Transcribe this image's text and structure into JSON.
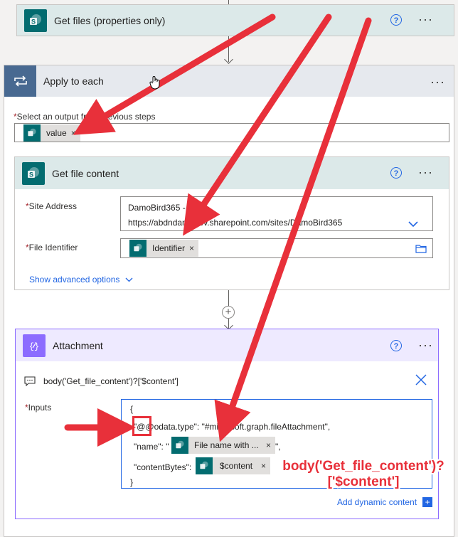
{
  "get_files": {
    "title": "Get files (properties only)"
  },
  "apply_each": {
    "title": "Apply to each",
    "select_label": "Select an output from previous steps",
    "token_value": "value"
  },
  "get_file_content": {
    "title": "Get file content",
    "site_label": "Site Address",
    "site_line1": "DamoBird365 -",
    "site_line2": "https://abdndamodev.sharepoint.com/sites/DamoBird365",
    "file_label": "File Identifier",
    "file_token": "Identifier",
    "advanced": "Show advanced options"
  },
  "attachment": {
    "title": "Attachment",
    "expression": "body('Get_file_content')?['$content']",
    "inputs_label": "Inputs",
    "json_open": "{",
    "odata_line": "\"@@odata.type\": \"#microsoft.graph.fileAttachment\",",
    "name_key": "\"name\": \"",
    "name_token": "File name with ...",
    "name_tail": "\",",
    "content_key": "\"contentBytes\":",
    "content_token": "$content",
    "json_close": "}",
    "add_dynamic": "Add dynamic content"
  },
  "common": {
    "help": "?",
    "more": "···",
    "remove": "×",
    "required": "*"
  },
  "annotation": {
    "line1": "body('Get_file_content')?",
    "line2": "['$content']"
  },
  "colors": {
    "sharepoint": "#036c70",
    "loop": "#486991",
    "compose": "#8c6cff",
    "arrow": "#e8303a"
  }
}
